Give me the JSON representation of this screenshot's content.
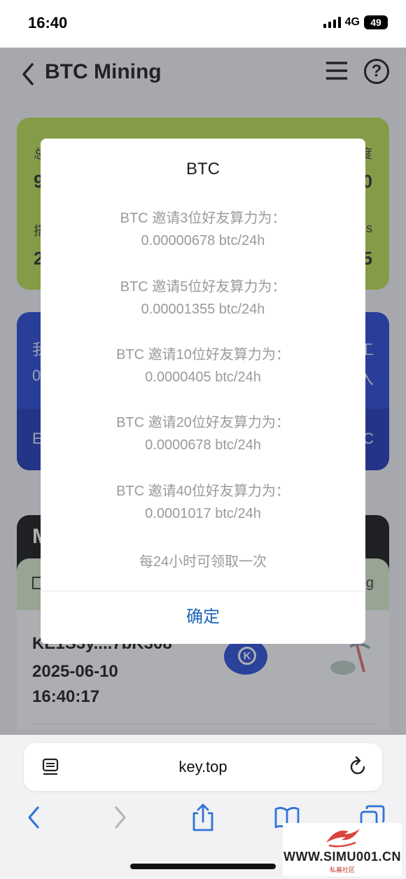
{
  "status_bar": {
    "time": "16:40",
    "network": "4G",
    "battery": "49"
  },
  "app": {
    "title": "BTC Mining",
    "green_card": {
      "left_label_1": "总",
      "left_value_1": "9",
      "right_label_1": "度",
      "right_value_1": "0",
      "left_label_2": "搭",
      "left_value_2": "2",
      "right_label_2": "s",
      "right_value_2": "5"
    },
    "blue_card": {
      "top_left": "我",
      "top_right": "工",
      "mid_left": "0",
      "mid_right": "入",
      "bottom_left": "E",
      "bottom_right": "C"
    },
    "black_card_letter": "M",
    "tab_right_text": "g",
    "record": {
      "address": "KE1S3y....7bK308",
      "date": "2025-06-10",
      "time": "16:40:17"
    }
  },
  "dialog": {
    "title": "BTC",
    "tiers": [
      {
        "line1": "BTC 邀请3位好友算力为：",
        "line2": "0.00000678 btc/24h"
      },
      {
        "line1": "BTC 邀请5位好友算力为：",
        "line2": "0.00001355 btc/24h"
      },
      {
        "line1": "BTC 邀请10位好友算力为：",
        "line2": "0.0000405 btc/24h"
      },
      {
        "line1": "BTC 邀请20位好友算力为：",
        "line2": "0.0000678 btc/24h"
      },
      {
        "line1": "BTC 邀请40位好友算力为：",
        "line2": "0.0001017 btc/24h"
      }
    ],
    "notice": "每24小时可领取一次",
    "confirm_label": "确定"
  },
  "browser": {
    "url": "key.top"
  },
  "watermark": {
    "text": "WWW.SIMU001.CN",
    "sub": "私募社区"
  },
  "colors": {
    "accent_blue": "#1e66b8",
    "card_green": "#b8e14b",
    "card_blue": "#1a3fd6"
  }
}
